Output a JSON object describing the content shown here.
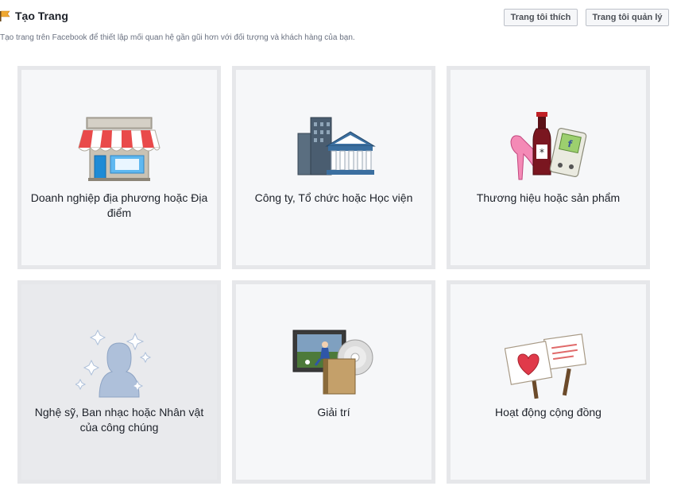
{
  "header": {
    "title": "Tạo Trang",
    "subtitle": "Tạo trang trên Facebook để thiết lập mối quan hệ gần gũi hơn với đối tượng và khách hàng của bạn.",
    "liked_pages_label": "Trang tôi thích",
    "managed_pages_label": "Trang tôi quản lý"
  },
  "categories": [
    {
      "label": "Doanh nghiệp địa phương hoặc Địa điểm",
      "icon": "storefront-icon"
    },
    {
      "label": "Công ty, Tổ chức hoặc Học viện",
      "icon": "building-icon"
    },
    {
      "label": "Thương hiệu hoặc sản phẩm",
      "icon": "products-icon"
    },
    {
      "label": "Nghệ sỹ, Ban nhạc hoặc Nhân vật của công chúng",
      "icon": "celebrity-icon"
    },
    {
      "label": "Giải trí",
      "icon": "entertainment-icon"
    },
    {
      "label": "Hoạt động cộng đồng",
      "icon": "community-signs-icon"
    }
  ],
  "colors": {
    "tile_bg": "#f6f7f9",
    "tile_border": "#e6e7ea",
    "tile_hover_bg": "#e9eaed"
  }
}
